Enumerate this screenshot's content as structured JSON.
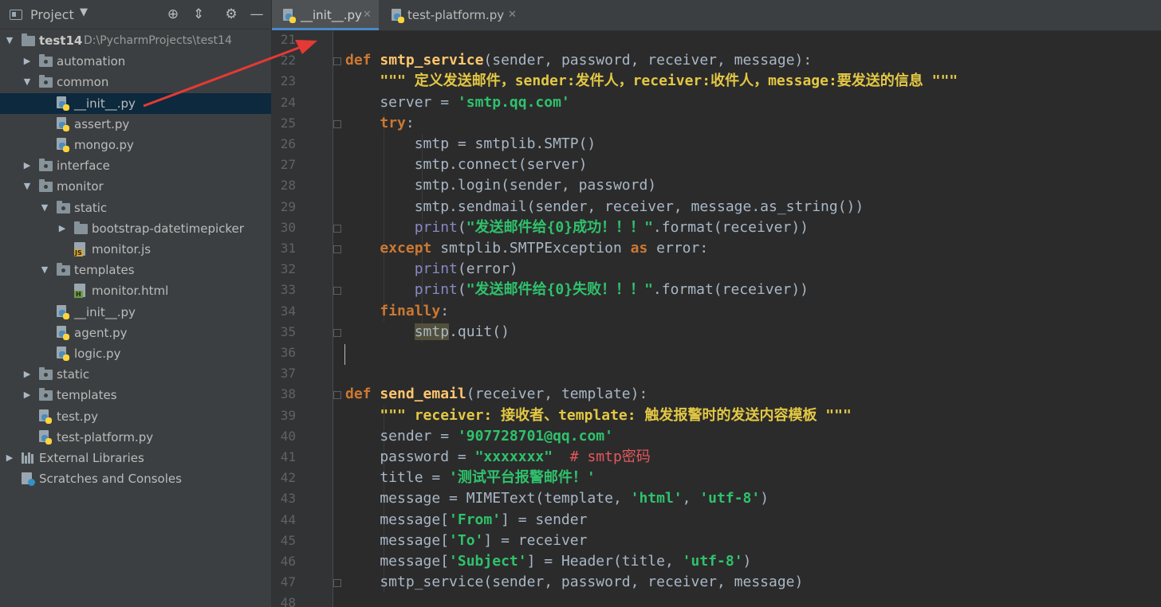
{
  "project_panel": {
    "title": "Project",
    "tree": [
      {
        "label": "test14",
        "path": "D:\\PycharmProjects\\test14",
        "type": "folder",
        "depth": 0,
        "expanded": true,
        "bold": true
      },
      {
        "label": "automation",
        "type": "pkg",
        "depth": 1,
        "expanded": false
      },
      {
        "label": "common",
        "type": "pkg",
        "depth": 1,
        "expanded": true
      },
      {
        "label": "__init__.py",
        "type": "py",
        "depth": 2,
        "selected": true
      },
      {
        "label": "assert.py",
        "type": "py",
        "depth": 2
      },
      {
        "label": "mongo.py",
        "type": "py",
        "depth": 2
      },
      {
        "label": "interface",
        "type": "pkg",
        "depth": 1,
        "expanded": false
      },
      {
        "label": "monitor",
        "type": "pkg",
        "depth": 1,
        "expanded": true
      },
      {
        "label": "static",
        "type": "pkg",
        "depth": 2,
        "expanded": true
      },
      {
        "label": "bootstrap-datetimepicker",
        "type": "folder",
        "depth": 3,
        "expanded": false
      },
      {
        "label": "monitor.js",
        "type": "js",
        "depth": 3
      },
      {
        "label": "templates",
        "type": "pkg",
        "depth": 2,
        "expanded": true
      },
      {
        "label": "monitor.html",
        "type": "html",
        "depth": 3
      },
      {
        "label": "__init__.py",
        "type": "py",
        "depth": 2
      },
      {
        "label": "agent.py",
        "type": "py",
        "depth": 2
      },
      {
        "label": "logic.py",
        "type": "py",
        "depth": 2
      },
      {
        "label": "static",
        "type": "pkg",
        "depth": 1,
        "expanded": false
      },
      {
        "label": "templates",
        "type": "pkg",
        "depth": 1,
        "expanded": false
      },
      {
        "label": "test.py",
        "type": "py",
        "depth": 1
      },
      {
        "label": "test-platform.py",
        "type": "py",
        "depth": 1
      },
      {
        "label": "External Libraries",
        "type": "lib",
        "depth": 0,
        "expanded": false
      },
      {
        "label": "Scratches and Consoles",
        "type": "scratch",
        "depth": 0
      }
    ]
  },
  "tabs": [
    {
      "label": "__init__.py",
      "active": true
    },
    {
      "label": "test-platform.py",
      "active": false
    }
  ],
  "colors": {
    "keyword": "#cc7832",
    "function": "#ffc66d",
    "string": "#6a8759",
    "docstring": "#629755",
    "comment": "#808080",
    "builtin": "#8888c6",
    "text": "#a9b7c6",
    "param": "#aa4926",
    "docstring_bold": "#e3c844",
    "string_bold": "#2fc26c",
    "comment_red": "#e5575d",
    "selection": "#0d293e",
    "arrow": "#e53935"
  },
  "editor": {
    "first_line_number": 21,
    "line_numbers": [
      "21",
      "22",
      "23",
      "24",
      "25",
      "26",
      "27",
      "28",
      "29",
      "30",
      "31",
      "32",
      "33",
      "34",
      "35",
      "36",
      "37",
      "38",
      "39",
      "40",
      "41",
      "42",
      "43",
      "44",
      "45",
      "46",
      "47",
      "48"
    ],
    "lines": [
      [],
      [
        [
          "def ",
          "kw"
        ],
        [
          "smtp_service",
          "fn"
        ],
        [
          "(sender, password, receiver, message):",
          "t"
        ]
      ],
      [
        [
          "    ",
          "t"
        ],
        [
          "\"\"\" 定义发送邮件，sender:发件人，receiver:收件人，message:要发送的信息 \"\"\"",
          "ds"
        ]
      ],
      [
        [
          "    server = ",
          "t"
        ],
        [
          "'smtp.qq.com'",
          "sb"
        ]
      ],
      [
        [
          "    ",
          "t"
        ],
        [
          "try",
          "kw"
        ],
        [
          ":",
          "t"
        ]
      ],
      [
        [
          "        smtp = smtplib.SMTP()",
          "t"
        ]
      ],
      [
        [
          "        smtp.connect(server)",
          "t"
        ]
      ],
      [
        [
          "        smtp.login(sender, password)",
          "t"
        ]
      ],
      [
        [
          "        smtp.sendmail(sender, receiver, message.as_string())",
          "t"
        ]
      ],
      [
        [
          "        ",
          "t"
        ],
        [
          "print",
          "bi"
        ],
        [
          "(",
          "t"
        ],
        [
          "\"发送邮件给{0}成功！！！\"",
          "sb"
        ],
        [
          ".format(receiver))",
          "t"
        ]
      ],
      [
        [
          "    ",
          "t"
        ],
        [
          "except ",
          "kw"
        ],
        [
          "smtplib.SMTPException ",
          "t"
        ],
        [
          "as ",
          "kw"
        ],
        [
          "error:",
          "t"
        ]
      ],
      [
        [
          "        ",
          "t"
        ],
        [
          "print",
          "bi"
        ],
        [
          "(error)",
          "t"
        ]
      ],
      [
        [
          "        ",
          "t"
        ],
        [
          "print",
          "bi"
        ],
        [
          "(",
          "t"
        ],
        [
          "\"发送邮件给{0}失败！！！\"",
          "sb"
        ],
        [
          ".format(receiver))",
          "t"
        ]
      ],
      [
        [
          "    ",
          "t"
        ],
        [
          "finally",
          "kw"
        ],
        [
          ":",
          "t"
        ]
      ],
      [
        [
          "        ",
          "t"
        ],
        [
          "smtp",
          "hl"
        ],
        [
          ".quit()",
          "t"
        ]
      ],
      [],
      [],
      [
        [
          "def ",
          "kw"
        ],
        [
          "send_email",
          "fn"
        ],
        [
          "(receiver, template):",
          "t"
        ]
      ],
      [
        [
          "    ",
          "t"
        ],
        [
          "\"\"\" receiver: 接收者、template: 触发报警时的发送内容模板 \"\"\"",
          "ds"
        ]
      ],
      [
        [
          "    sender = ",
          "t"
        ],
        [
          "'907728701@qq.com'",
          "sb"
        ]
      ],
      [
        [
          "    password = ",
          "t"
        ],
        [
          "\"xxxxxxx\"",
          "sb"
        ],
        [
          "  # smtp密码",
          "cr"
        ]
      ],
      [
        [
          "    title = ",
          "t"
        ],
        [
          "'测试平台报警邮件！'",
          "sb"
        ]
      ],
      [
        [
          "    message = MIMEText(template, ",
          "t"
        ],
        [
          "'html'",
          "sb"
        ],
        [
          ", ",
          "t"
        ],
        [
          "'utf-8'",
          "sb"
        ],
        [
          ")",
          "t"
        ]
      ],
      [
        [
          "    message[",
          "t"
        ],
        [
          "'From'",
          "sb"
        ],
        [
          "] = sender",
          "t"
        ]
      ],
      [
        [
          "    message[",
          "t"
        ],
        [
          "'To'",
          "sb"
        ],
        [
          "] = receiver",
          "t"
        ]
      ],
      [
        [
          "    message[",
          "t"
        ],
        [
          "'Subject'",
          "sb"
        ],
        [
          "] = Header(title, ",
          "t"
        ],
        [
          "'utf-8'",
          "sb"
        ],
        [
          ")",
          "t"
        ]
      ],
      [
        [
          "    smtp_service(sender, password, receiver, message)",
          "t"
        ]
      ],
      []
    ]
  }
}
